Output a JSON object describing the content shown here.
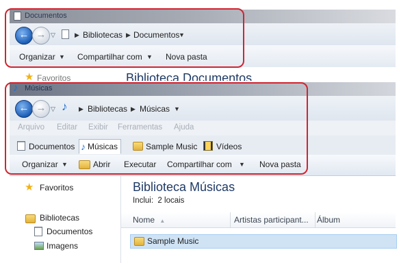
{
  "window_back": {
    "title": "Documentos",
    "breadcrumb": [
      "Bibliotecas",
      "Documentos"
    ],
    "toolbar": [
      "Organizar",
      "Compartilhar com",
      "Nova pasta"
    ],
    "nav_partial": "Favoritos",
    "heading_partial": "Biblioteca Documentos"
  },
  "window_front": {
    "title": "Músicas",
    "breadcrumb": [
      "Bibliotecas",
      "Músicas"
    ],
    "menu": [
      "Arquivo",
      "Editar",
      "Exibir",
      "Ferramentas",
      "Ajuda"
    ],
    "tabs": [
      "Documentos",
      "Músicas",
      "Sample Music",
      "Vídeos"
    ],
    "toolbar": [
      "Organizar",
      "Abrir",
      "Executar",
      "Compartilhar com",
      "Nova pasta"
    ],
    "nav": {
      "favorites": "Favoritos",
      "libraries": "Bibliotecas",
      "documents": "Documentos",
      "images": "Imagens"
    },
    "heading": "Biblioteca Músicas",
    "includes": "Inclui:  2 locais",
    "columns": [
      "Nome",
      "Artistas participant...",
      "Álbum"
    ],
    "rows": [
      "Sample Music"
    ]
  },
  "colors": {
    "highlight": "#cf2430",
    "selection": "#cfe3f5"
  }
}
